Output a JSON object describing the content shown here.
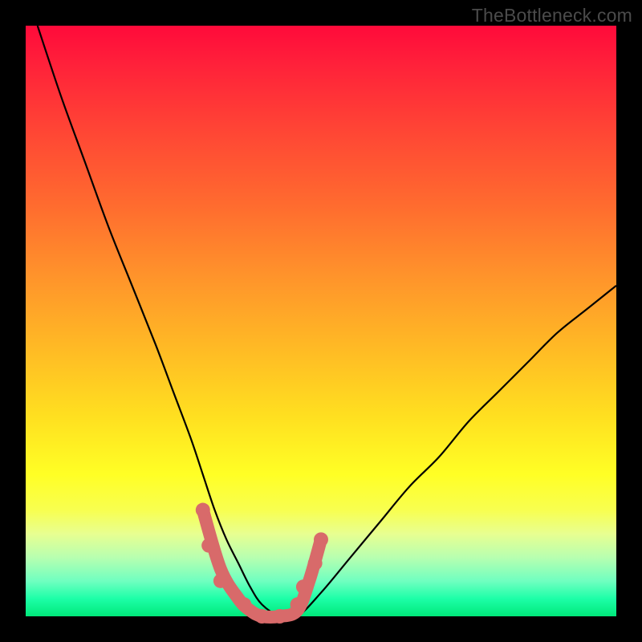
{
  "watermark": "TheBottleneck.com",
  "chart_data": {
    "type": "line",
    "title": "",
    "xlabel": "",
    "ylabel": "",
    "xlim": [
      0,
      100
    ],
    "ylim": [
      0,
      100
    ],
    "grid": false,
    "legend": false,
    "series": [
      {
        "name": "bottleneck-curve",
        "color": "#000000",
        "x": [
          2,
          6,
          10,
          14,
          18,
          22,
          25,
          28,
          30,
          32,
          34,
          36,
          38,
          40,
          43,
          46,
          50,
          55,
          60,
          65,
          70,
          75,
          80,
          85,
          90,
          95,
          100
        ],
        "values": [
          100,
          88,
          77,
          66,
          56,
          46,
          38,
          30,
          24,
          18,
          13,
          9,
          5,
          2,
          0,
          0,
          4,
          10,
          16,
          22,
          27,
          33,
          38,
          43,
          48,
          52,
          56
        ]
      },
      {
        "name": "highlight-dots",
        "color": "#d86a6a",
        "type": "scatter",
        "x": [
          30,
          31,
          33,
          37,
          40,
          43,
          46,
          47,
          49,
          50
        ],
        "values": [
          18,
          12,
          6,
          2,
          0,
          0,
          2,
          5,
          9,
          13
        ]
      }
    ],
    "highlight_segment": {
      "color": "#d86a6a",
      "x": [
        30,
        33,
        36,
        38,
        40,
        43,
        46,
        48,
        50
      ],
      "values": [
        18,
        8,
        3,
        1,
        0,
        0,
        1,
        6,
        13
      ]
    }
  }
}
